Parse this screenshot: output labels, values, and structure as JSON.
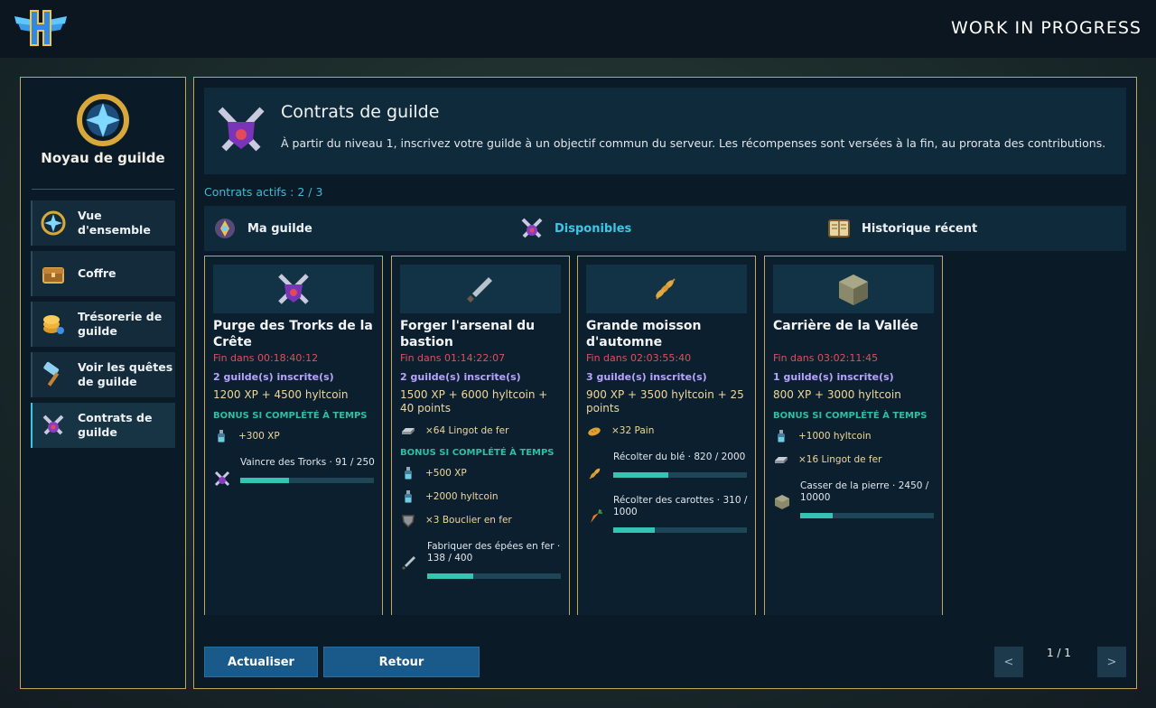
{
  "topbar": {
    "status": "WORK IN PROGRESS",
    "logo_icon": "winged-h-logo"
  },
  "sidebar": {
    "title": "Noyau de guilde",
    "items": [
      {
        "label": "Vue d'ensemble",
        "icon": "star-emblem-icon"
      },
      {
        "label": "Coffre",
        "icon": "chest-icon"
      },
      {
        "label": "Trésorerie de guilde",
        "icon": "coins-icon"
      },
      {
        "label": "Voir les quêtes de guilde",
        "icon": "hammer-icon"
      },
      {
        "label": "Contrats de guilde",
        "icon": "crossed-swords-icon",
        "active": true
      }
    ]
  },
  "header": {
    "title": "Contrats de guilde",
    "description": "À partir du niveau 1, inscrivez votre guilde à un objectif commun du serveur. Les récompenses sont versées à la fin, au prorata des contributions."
  },
  "active_count": "Contrats actifs : 2 / 3",
  "tabs": [
    {
      "label": "Ma guilde",
      "icon": "guild-crest-icon"
    },
    {
      "label": "Disponibles",
      "icon": "crossed-swords-icon",
      "active": true
    },
    {
      "label": "Historique récent",
      "icon": "book-icon"
    }
  ],
  "bonus_heading": "BONUS SI COMPLÉTÉ À TEMPS",
  "cards": [
    {
      "title": "Purge des Trorks de la Crête",
      "timer": "Fin dans 00:18:40:12",
      "guilds": "2 guilde(s) inscrite(s)",
      "reward": "1200 XP + 4500 hyltcoin",
      "items": [],
      "bonus": [
        {
          "label": "+300 XP",
          "icon": "potion-icon"
        }
      ],
      "tasks": [
        {
          "label": "Vaincre des Trorks · 91 / 250",
          "progress": 0.364,
          "icon": "crossed-swords-icon"
        }
      ]
    },
    {
      "title": "Forger l'arsenal du bastion",
      "timer": "Fin dans 01:14:22:07",
      "guilds": "2 guilde(s) inscrite(s)",
      "reward": "1500 XP + 6000 hyltcoin + 40 points",
      "items": [
        {
          "label": "×64 Lingot de fer",
          "icon": "iron-ingot-icon"
        }
      ],
      "bonus": [
        {
          "label": "+500 XP",
          "icon": "potion-icon"
        },
        {
          "label": "+2000 hyltcoin",
          "icon": "potion-icon"
        },
        {
          "label": "×3 Bouclier en fer",
          "icon": "shield-icon"
        }
      ],
      "tasks": [
        {
          "label": "Fabriquer des épées en fer · 138 / 400",
          "progress": 0.345,
          "icon": "sword-icon"
        }
      ]
    },
    {
      "title": "Grande moisson d'automne",
      "timer": "Fin dans 02:03:55:40",
      "guilds": "3 guilde(s) inscrite(s)",
      "reward": "900 XP + 3500 hyltcoin + 25 points",
      "items": [
        {
          "label": "×32 Pain",
          "icon": "bread-icon"
        }
      ],
      "bonus": [],
      "tasks": [
        {
          "label": "Récolter du blé · 820 / 2000",
          "progress": 0.41,
          "icon": "wheat-icon"
        },
        {
          "label": "Récolter des carottes · 310 / 1000",
          "progress": 0.31,
          "icon": "carrot-icon"
        }
      ]
    },
    {
      "title": "Carrière de la Vallée",
      "timer": "Fin dans 03:02:11:45",
      "guilds": "1 guilde(s) inscrite(s)",
      "reward": "800 XP + 3000 hyltcoin",
      "items": [],
      "bonus": [
        {
          "label": "+1000 hyltcoin",
          "icon": "potion-icon"
        },
        {
          "label": "×16 Lingot de fer",
          "icon": "iron-ingot-icon"
        }
      ],
      "tasks": [
        {
          "label": "Casser de la pierre · 2450 / 10000",
          "progress": 0.245,
          "icon": "stone-block-icon"
        }
      ]
    }
  ],
  "footer": {
    "refresh_label": "Actualiser",
    "back_label": "Retour",
    "page": "1 / 1",
    "prev": "<",
    "next": ">"
  }
}
